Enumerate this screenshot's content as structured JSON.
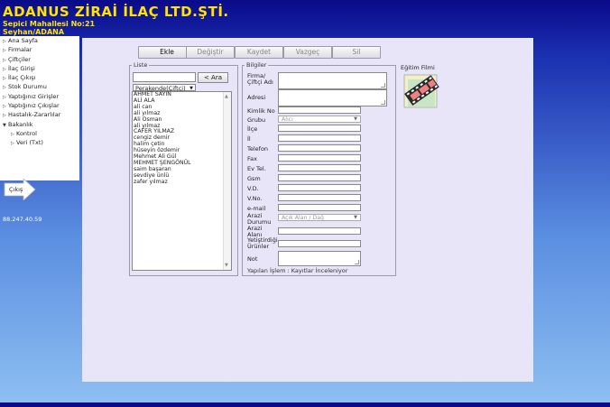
{
  "header": {
    "company": "ADANUS ZİRAİ İLAÇ LTD.ŞTİ.",
    "address_line1": "Sepici Mahallesi No:21",
    "address_line2": "Seyhan/ADANA"
  },
  "menu": {
    "items": [
      {
        "label": "Ana Sayfa"
      },
      {
        "label": "Firmalar"
      },
      {
        "label": "Çiftçiler"
      },
      {
        "label": "İlaç Girişi"
      },
      {
        "label": "İlaç Çıkışı"
      },
      {
        "label": "Stok Durumu"
      },
      {
        "label": "Yaptığınız Girişler"
      },
      {
        "label": "Yaptığınız Çıkışlar"
      },
      {
        "label": "Hastalık-Zararlılar"
      },
      {
        "label": "Bakanlık"
      },
      {
        "label": "Kontrol"
      },
      {
        "label": "Veri (Txt)"
      }
    ]
  },
  "exit_label": "Çıkış",
  "ip_address": "88.247.40.59",
  "toolbar": {
    "add": "Ekle",
    "change": "Değiştir",
    "save": "Kaydet",
    "cancel": "Vazgeç",
    "delete": "Sil"
  },
  "list": {
    "legend": "Liste",
    "search_value": "",
    "search_button": "< Ara",
    "type_selected": "Perakende(Çiftçi)",
    "items": [
      "AHMET SAYIN",
      "ALİ ALA",
      "ali can",
      "ali yılmaz",
      "Ali Osman",
      "ali yılmaz",
      "CAFER YILMAZ",
      "cengiz demir",
      "halim çetin",
      "hüseyin özdemir",
      "Mehmet Ali Gül",
      "MEHMET ŞENGÖNÜL",
      "saim başaran",
      "sevdiye ünlü",
      "zafer yılmaz"
    ]
  },
  "details": {
    "legend": "Bilgiler",
    "firm_label": "Firma/ Çiftçi Adı",
    "address_label": "Adresi",
    "id_label": "Kimlik No",
    "group_label": "Grubu",
    "group_value": "Alıcı",
    "district_label": "İlçe",
    "city_label": "İl",
    "phone_label": "Telefon",
    "fax_label": "Fax",
    "home_phone_label": "Ev Tel.",
    "mobile_label": "Gsm",
    "tax_office_label": "V.D.",
    "tax_no_label": "V.No.",
    "email_label": "e-mail",
    "land_status_label": "Arazi Durumu",
    "land_status_value": "Açık Alan / Dağ",
    "land_area_label": "Arazi Alanı",
    "products_label": "Yetiştirdiği Ürünler",
    "note_label": "Not",
    "status_text": "Yapılan İşlem : Kayıtlar İnceleniyor"
  },
  "training": {
    "label": "Eğitim Filmi",
    "icon": "film-reel-icon"
  }
}
